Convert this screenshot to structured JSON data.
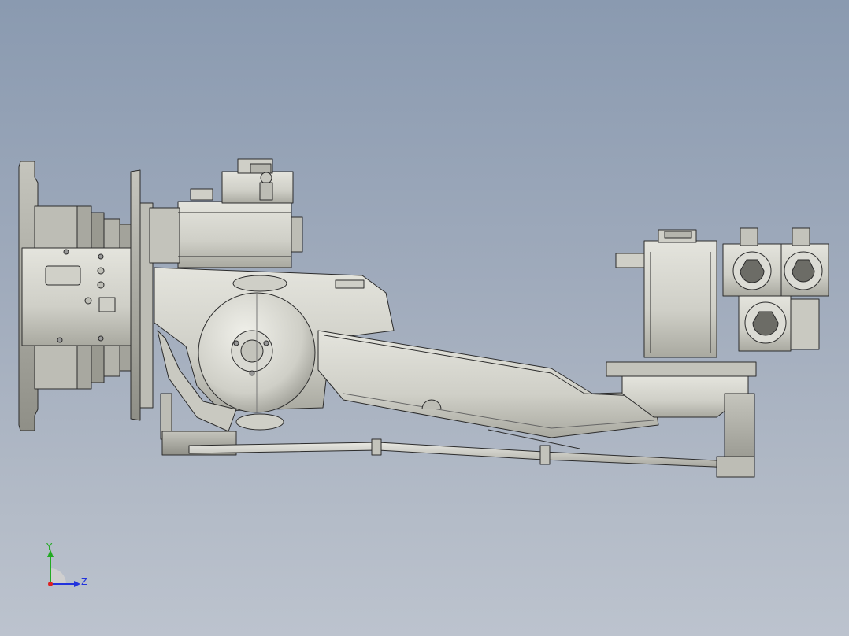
{
  "viewport": {
    "background_top": "#8a9ab0",
    "background_bottom": "#bcc3ce"
  },
  "model": {
    "fill": "#d6d6cf",
    "fill_dark": "#a9a9a1",
    "stroke": "#2b2b2b"
  },
  "triad": {
    "y_label": "Y",
    "z_label": "Z",
    "y_color": "#22aa22",
    "z_color": "#2233dd",
    "x_color": "#dd2222"
  }
}
